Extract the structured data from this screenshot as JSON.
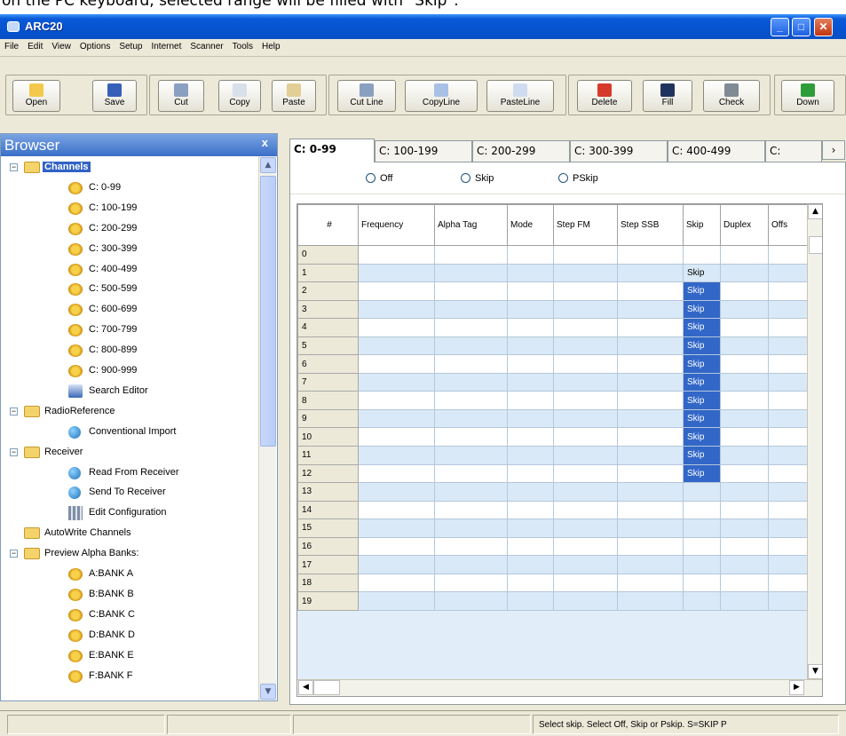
{
  "caption": "on the PC keyboard, selected range will be filled with \"Skip\".",
  "window": {
    "title": "ARC20"
  },
  "menu": [
    "File",
    "Edit",
    "View",
    "Options",
    "Setup",
    "Internet",
    "Scanner",
    "Tools",
    "Help"
  ],
  "toolbar": {
    "open": "Open",
    "save": "Save",
    "cut": "Cut",
    "copy": "Copy",
    "paste": "Paste",
    "cut_line": "Cut Line",
    "copy_line": "CopyLine",
    "paste_line": "PasteLine",
    "delete": "Delete",
    "fill": "Fill",
    "check": "Check",
    "down": "Down"
  },
  "browser": {
    "title": "Browser",
    "close": "x",
    "items": [
      {
        "label": "Channels",
        "icon": "folder-icon",
        "level": 1,
        "expand": "−",
        "selected": true
      },
      {
        "label": "C: 0-99",
        "icon": "channel-icon",
        "level": 2
      },
      {
        "label": "C: 100-199",
        "icon": "channel-icon",
        "level": 2
      },
      {
        "label": "C: 200-299",
        "icon": "channel-icon",
        "level": 2
      },
      {
        "label": "C: 300-399",
        "icon": "channel-icon",
        "level": 2
      },
      {
        "label": "C: 400-499",
        "icon": "channel-icon",
        "level": 2
      },
      {
        "label": "C: 500-599",
        "icon": "channel-icon",
        "level": 2
      },
      {
        "label": "C: 600-699",
        "icon": "channel-icon",
        "level": 2
      },
      {
        "label": "C: 700-799",
        "icon": "channel-icon",
        "level": 2
      },
      {
        "label": "C: 800-899",
        "icon": "channel-icon",
        "level": 2
      },
      {
        "label": "C: 900-999",
        "icon": "channel-icon",
        "level": 2
      },
      {
        "label": "Search Editor",
        "icon": "search-editor-icon",
        "level": 2
      },
      {
        "label": "RadioReference",
        "icon": "folder-icon",
        "level": 1,
        "expand": "−"
      },
      {
        "label": "Conventional Import",
        "icon": "globe-icon",
        "level": 2
      },
      {
        "label": "Receiver",
        "icon": "folder-icon",
        "level": 1,
        "expand": "−"
      },
      {
        "label": "Read From Receiver",
        "icon": "globe-icon",
        "level": 2
      },
      {
        "label": "Send To Receiver",
        "icon": "globe-icon",
        "level": 2
      },
      {
        "label": "Edit Configuration",
        "icon": "config-icon",
        "level": 2
      },
      {
        "label": "AutoWrite Channels",
        "icon": "folder-icon",
        "level": 1
      },
      {
        "label": "Preview Alpha Banks:",
        "icon": "folder-icon",
        "level": 1,
        "expand": "−"
      },
      {
        "label": "A:BANK A",
        "icon": "channel-icon",
        "level": 2
      },
      {
        "label": "B:BANK B",
        "icon": "channel-icon",
        "level": 2
      },
      {
        "label": "C:BANK C",
        "icon": "channel-icon",
        "level": 2
      },
      {
        "label": "D:BANK D",
        "icon": "channel-icon",
        "level": 2
      },
      {
        "label": "E:BANK E",
        "icon": "channel-icon",
        "level": 2
      },
      {
        "label": "F:BANK F",
        "icon": "channel-icon",
        "level": 2
      }
    ]
  },
  "tabs": [
    "C: 0-99",
    "C: 100-199",
    "C: 200-299",
    "C: 300-399",
    "C: 400-499",
    "C:"
  ],
  "radios": [
    {
      "label": "Off"
    },
    {
      "label": "Skip"
    },
    {
      "label": "PSkip"
    }
  ],
  "grid": {
    "columns": [
      "#",
      "Frequency",
      "Alpha Tag",
      "Mode",
      "Step FM",
      "Step SSB",
      "Skip",
      "Duplex",
      "Offs"
    ],
    "rows": [
      {
        "num": "0",
        "skip": ""
      },
      {
        "num": "1",
        "skip": "Skip"
      },
      {
        "num": "2",
        "skip": "Skip",
        "sel": true
      },
      {
        "num": "3",
        "skip": "Skip",
        "sel": true
      },
      {
        "num": "4",
        "skip": "Skip",
        "sel": true
      },
      {
        "num": "5",
        "skip": "Skip",
        "sel": true
      },
      {
        "num": "6",
        "skip": "Skip",
        "sel": true
      },
      {
        "num": "7",
        "skip": "Skip",
        "sel": true
      },
      {
        "num": "8",
        "skip": "Skip",
        "sel": true
      },
      {
        "num": "9",
        "skip": "Skip",
        "sel": true
      },
      {
        "num": "10",
        "skip": "Skip",
        "sel": true
      },
      {
        "num": "11",
        "skip": "Skip",
        "sel": true
      },
      {
        "num": "12",
        "skip": "Skip",
        "sel": true
      },
      {
        "num": "13",
        "skip": ""
      },
      {
        "num": "14",
        "skip": ""
      },
      {
        "num": "15",
        "skip": ""
      },
      {
        "num": "16",
        "skip": ""
      },
      {
        "num": "17",
        "skip": ""
      },
      {
        "num": "18",
        "skip": ""
      },
      {
        "num": "19",
        "skip": ""
      }
    ]
  },
  "status": {
    "message": "Select skip. Select Off, Skip or Pskip. S=SKIP P"
  }
}
